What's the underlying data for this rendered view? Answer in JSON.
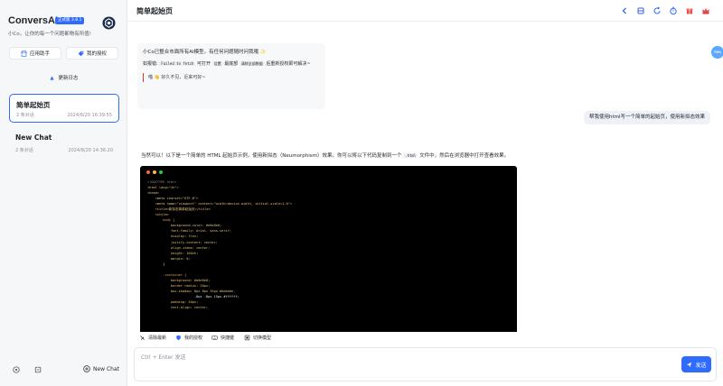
{
  "app": {
    "name": "ConversAI",
    "badge": "正式版 3.8.1",
    "tagline": "小Co，让你的每一个问题都物有所值!",
    "accent": "#2f6bff"
  },
  "sidebar": {
    "assistant_label": "应用助手",
    "license_label": "我的授权",
    "changelog_label": "更新日志",
    "conversations": [
      {
        "title": "简单起始页",
        "count": "2 条对话",
        "date": "2024/8/20 16:39:55"
      },
      {
        "title": "New Chat",
        "count": "2 条对话",
        "date": "2024/8/20 14:36:20"
      }
    ],
    "new_chat_label": "New Chat"
  },
  "header": {
    "title": "简单起始页"
  },
  "chat": {
    "bot1": {
      "line1": "小Co已整合市面所有AI模型。有任何问题随时问我哦 ✨",
      "line2_prefix": "如报错:",
      "line2_code": "Failed to fetch",
      "line2_mid": "可打开",
      "line2_code2": "设置",
      "line2_mid2": "最底部",
      "line2_code3": "清除全部数据",
      "line2_suffix": "后重新授权即可解决~",
      "quote": "喵 👋 好久不见，近来可好~"
    },
    "user_message": "帮我使用html写一个简单的起始页，使用新拟态效果",
    "bot2": {
      "text_prefix": "当然可以！以下是一个简单的 HTML 起始页示例，使用新拟态（Neumorphism）效果。你可以将以下代码复制到一个",
      "text_code": ".html",
      "text_suffix": "文件中，然后在浏览器中打开查看效果。",
      "code_lines": [
        "<!DOCTYPE html>",
        "<html lang=\"zh\">",
        "<head>",
        "    <meta charset=\"UTF-8\">",
        "    <meta name=\"viewport\" content=\"width=device-width, initial-scale=1.0\">",
        "    <title>新拟态简单起始页</title>",
        "    <style>",
        "        body {",
        "            background-color: #e0e0e0;",
        "            font-family: Arial, sans-serif;",
        "            display: flex;",
        "            justify-content: center;",
        "            align-items: center;",
        "            height: 100vh;",
        "            margin: 0;",
        "        }",
        "",
        "        .container {",
        "            background: #e0e0e0;",
        "            border-radius: 20px;",
        "            box-shadow: 8px 8px 15px #bebebe,",
        "                        -8px -8px 15px #ffffff;",
        "            padding: 40px;",
        "            text-align: center;"
      ]
    },
    "fab_label": "79%"
  },
  "toolbar": {
    "items": [
      "清除最新",
      "我的授权",
      "快捷键",
      "切换模型"
    ]
  },
  "input": {
    "placeholder": "Ctrl + Enter 发送",
    "send_label": "发送"
  }
}
